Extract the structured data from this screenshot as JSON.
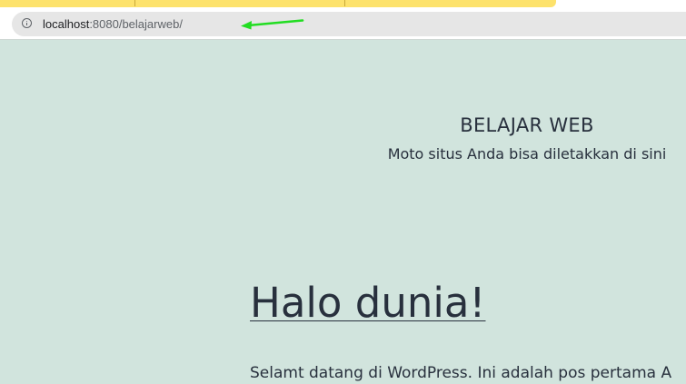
{
  "browser": {
    "url_host": "localhost",
    "url_rest": ":8080/belajarweb/",
    "tab_color": "#fde26c",
    "annotation_arrow_color": "#22dd22"
  },
  "site": {
    "title": "BELAJAR WEB",
    "tagline": "Moto situs Anda bisa diletakkan di sini",
    "background_color": "#d1e4dd"
  },
  "post": {
    "title": "Halo dunia!",
    "excerpt": "Selamt datang di WordPress. Ini adalah pos pertama A"
  }
}
